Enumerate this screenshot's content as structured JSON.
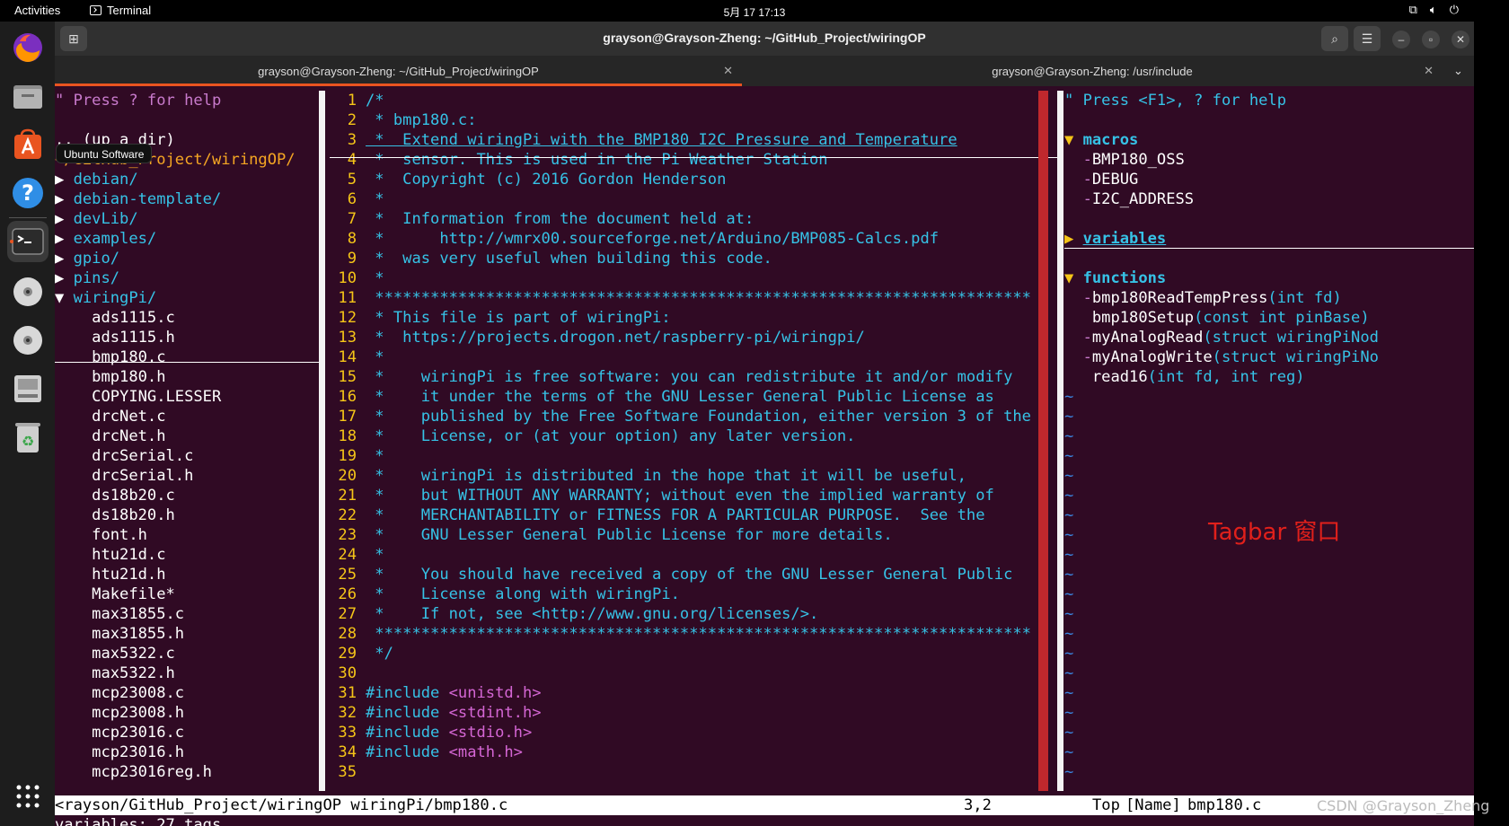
{
  "topbar": {
    "activities": "Activities",
    "app": "Terminal",
    "clock": "5月 17  17:13"
  },
  "dock": {
    "tooltip": "Ubuntu Software"
  },
  "window": {
    "title": "grayson@Grayson-Zheng: ~/GitHub_Project/wiringOP",
    "tabs": [
      {
        "label": "grayson@Grayson-Zheng: ~/GitHub_Project/wiringOP"
      },
      {
        "label": "grayson@Grayson-Zheng: /usr/include"
      }
    ]
  },
  "nerdtree": {
    "help": "\" Press ? for help",
    "up": ".. (up a dir)",
    "root": "</GitHub_Project/wiringOP/",
    "dirs": [
      "debian/",
      "debian-template/",
      "devLib/",
      "examples/",
      "gpio/",
      "pins/"
    ],
    "open_dir": "wiringPi/",
    "files": [
      "ads1115.c",
      "ads1115.h",
      "bmp180.c",
      "bmp180.h",
      "COPYING.LESSER",
      "drcNet.c",
      "drcNet.h",
      "drcSerial.c",
      "drcSerial.h",
      "ds18b20.c",
      "ds18b20.h",
      "font.h",
      "htu21d.c",
      "htu21d.h",
      "Makefile*",
      "max31855.c",
      "max31855.h",
      "max5322.c",
      "max5322.h",
      "mcp23008.c",
      "mcp23008.h",
      "mcp23016.c",
      "mcp23016.h",
      "mcp23016reg.h"
    ]
  },
  "editor": {
    "lines": [
      {
        "n": "1",
        "t": "/*",
        "k": "cm"
      },
      {
        "n": "2",
        "t": " * bmp180.c:",
        "k": "cm"
      },
      {
        "n": "3",
        "t": " *  Extend wiringPi with the BMP180 I2C Pressure and Temperature",
        "k": "cm ul"
      },
      {
        "n": "4",
        "t": " *  sensor. This is used in the Pi Weather Station",
        "k": "cm"
      },
      {
        "n": "5",
        "t": " *  Copyright (c) 2016 Gordon Henderson",
        "k": "cm"
      },
      {
        "n": "6",
        "t": " *",
        "k": "cm"
      },
      {
        "n": "7",
        "t": " *  Information from the document held at:",
        "k": "cm"
      },
      {
        "n": "8",
        "t": " *      http://wmrx00.sourceforge.net/Arduino/BMP085-Calcs.pdf",
        "k": "cm"
      },
      {
        "n": "9",
        "t": " *  was very useful when building this code.",
        "k": "cm"
      },
      {
        "n": "10",
        "t": " *",
        "k": "cm"
      },
      {
        "n": "11",
        "t": " ***********************************************************************",
        "k": "cm"
      },
      {
        "n": "12",
        "t": " * This file is part of wiringPi:",
        "k": "cm"
      },
      {
        "n": "13",
        "t": " *  https://projects.drogon.net/raspberry-pi/wiringpi/",
        "k": "cm"
      },
      {
        "n": "14",
        "t": " *",
        "k": "cm"
      },
      {
        "n": "15",
        "t": " *    wiringPi is free software: you can redistribute it and/or modify",
        "k": "cm"
      },
      {
        "n": "16",
        "t": " *    it under the terms of the GNU Lesser General Public License as",
        "k": "cm"
      },
      {
        "n": "17",
        "t": " *    published by the Free Software Foundation, either version 3 of the",
        "k": "cm"
      },
      {
        "n": "18",
        "t": " *    License, or (at your option) any later version.",
        "k": "cm"
      },
      {
        "n": "19",
        "t": " *",
        "k": "cm"
      },
      {
        "n": "20",
        "t": " *    wiringPi is distributed in the hope that it will be useful,",
        "k": "cm"
      },
      {
        "n": "21",
        "t": " *    but WITHOUT ANY WARRANTY; without even the implied warranty of",
        "k": "cm"
      },
      {
        "n": "22",
        "t": " *    MERCHANTABILITY or FITNESS FOR A PARTICULAR PURPOSE.  See the",
        "k": "cm"
      },
      {
        "n": "23",
        "t": " *    GNU Lesser General Public License for more details.",
        "k": "cm"
      },
      {
        "n": "24",
        "t": " *",
        "k": "cm"
      },
      {
        "n": "25",
        "t": " *    You should have received a copy of the GNU Lesser General Public",
        "k": "cm"
      },
      {
        "n": "26",
        "t": " *    License along with wiringPi.",
        "k": "cm"
      },
      {
        "n": "27",
        "t": " *    If not, see <http://www.gnu.org/licenses/>.",
        "k": "cm"
      },
      {
        "n": "28",
        "t": " ***********************************************************************",
        "k": "cm"
      },
      {
        "n": "29",
        "t": " */",
        "k": "cm"
      },
      {
        "n": "30",
        "t": "",
        "k": ""
      },
      {
        "n": "31",
        "t": "#include ",
        "inc": "<unistd.h>",
        "k": "pp"
      },
      {
        "n": "32",
        "t": "#include ",
        "inc": "<stdint.h>",
        "k": "pp"
      },
      {
        "n": "33",
        "t": "#include ",
        "inc": "<stdio.h>",
        "k": "pp"
      },
      {
        "n": "34",
        "t": "#include ",
        "inc": "<math.h>",
        "k": "pp"
      },
      {
        "n": "35",
        "t": "",
        "k": ""
      }
    ]
  },
  "tagbar": {
    "help": "\" Press <F1>, ? for help",
    "groups": [
      {
        "name": "macros",
        "open": true,
        "items": [
          {
            "prefix": "-",
            "name": "BMP180_OSS",
            "sig": ""
          },
          {
            "prefix": "-",
            "name": "DEBUG",
            "sig": ""
          },
          {
            "prefix": "-",
            "name": "I2C_ADDRESS",
            "sig": ""
          }
        ]
      },
      {
        "name": "variables",
        "open": false,
        "items": []
      },
      {
        "name": "functions",
        "open": true,
        "items": [
          {
            "prefix": "-",
            "name": "bmp180ReadTempPress",
            "sig": "(int fd)"
          },
          {
            "prefix": " ",
            "name": "bmp180Setup",
            "sig": "(const int pinBase)"
          },
          {
            "prefix": "-",
            "name": "myAnalogRead",
            "sig": "(struct wiringPiNod"
          },
          {
            "prefix": "-",
            "name": "myAnalogWrite",
            "sig": "(struct wiringPiNo"
          },
          {
            "prefix": " ",
            "name": "read16",
            "sig": "(int fd, int reg)"
          }
        ]
      }
    ],
    "tilde": "~"
  },
  "statusline": {
    "left": "<rayson/GitHub_Project/wiringOP",
    "file": "wiringPi/bmp180.c",
    "pos": "3,2",
    "top": "Top",
    "tagname": "[Name]",
    "tagfile": "bmp180.c"
  },
  "cmdline": "variables: 27 tags",
  "annotation": "Tagbar 窗口",
  "watermark": "CSDN @Grayson_Zheng",
  "colors": {
    "terminal_bg": "#300a24",
    "accent": "#e95420",
    "comment": "#36c2e6",
    "line_number": "#f5c518",
    "include_string": "#d466d4",
    "annotation": "#e0201b"
  }
}
